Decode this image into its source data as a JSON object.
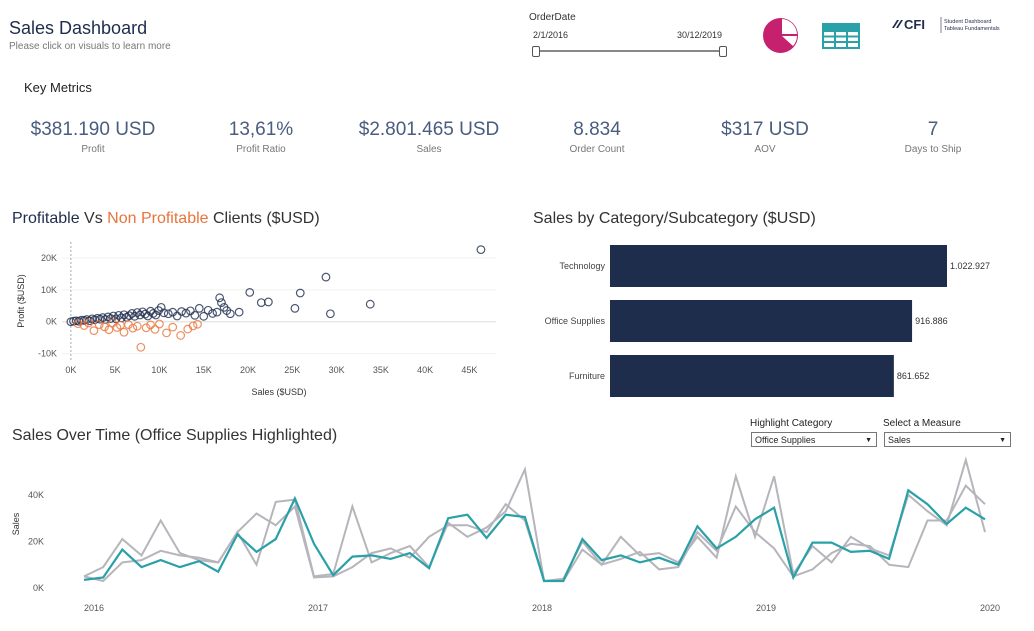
{
  "header": {
    "title": "Sales Dashboard",
    "subtitle": "Please click on visuals to learn more"
  },
  "filter": {
    "label": "OrderDate",
    "start": "2/1/2016",
    "end": "30/12/2019"
  },
  "icons": {
    "pie": "pie-chart-icon",
    "table": "table-icon",
    "logo_text": "CFI",
    "logo_sub1": "Student Dashboard",
    "logo_sub2": "Tableau Fundamentals"
  },
  "key_metrics": {
    "label": "Key Metrics",
    "items": [
      {
        "value": "$381.190 USD",
        "label": "Profit"
      },
      {
        "value": "13,61%",
        "label": "Profit Ratio"
      },
      {
        "value": "$2.801.465 USD",
        "label": "Sales"
      },
      {
        "value": "8.834",
        "label": "Order Count"
      },
      {
        "value": "$317 USD",
        "label": "AOV"
      },
      {
        "value": "7",
        "label": "Days to Ship"
      }
    ]
  },
  "scatter_title": {
    "part1": "Profitable",
    "part2": " Vs ",
    "part3": "Non Profitable",
    "part4": " Clients ($USD)"
  },
  "bar_title": "Sales by Category/Subcategory ($USD)",
  "line_title": "Sales Over Time (Office Supplies Highlighted)",
  "controls": {
    "highlight_label": "Highlight Category",
    "highlight_value": "Office Supplies",
    "measure_label": "Select a Measure",
    "measure_value": "Sales"
  },
  "colors": {
    "navy": "#1f2d4d",
    "orange": "#e8743b",
    "teal": "#2aa0a8",
    "gray": "#b5b5bb",
    "magenta": "#c5216e"
  },
  "chart_data": [
    {
      "type": "scatter",
      "xlabel": "Sales ($USD)",
      "ylabel": "Profit ($USD)",
      "xlim": [
        -1000,
        48000
      ],
      "ylim": [
        -12000,
        25000
      ],
      "x_ticks": [
        "0K",
        "5K",
        "10K",
        "15K",
        "20K",
        "25K",
        "30K",
        "35K",
        "40K",
        "45K"
      ],
      "y_ticks": [
        "20K",
        "10K",
        "0K",
        "-10K"
      ],
      "series": [
        {
          "name": "Profitable",
          "points": [
            [
              0,
              0
            ],
            [
              300,
              200
            ],
            [
              600,
              300
            ],
            [
              900,
              150
            ],
            [
              1200,
              500
            ],
            [
              1500,
              400
            ],
            [
              1800,
              700
            ],
            [
              2100,
              300
            ],
            [
              2400,
              900
            ],
            [
              2700,
              600
            ],
            [
              3000,
              1100
            ],
            [
              3300,
              800
            ],
            [
              3600,
              1300
            ],
            [
              3900,
              700
            ],
            [
              4200,
              1500
            ],
            [
              4500,
              1000
            ],
            [
              4800,
              1800
            ],
            [
              5100,
              900
            ],
            [
              5400,
              2000
            ],
            [
              5700,
              1200
            ],
            [
              6000,
              2200
            ],
            [
              6300,
              1400
            ],
            [
              6600,
              1900
            ],
            [
              6900,
              2600
            ],
            [
              7200,
              1700
            ],
            [
              7500,
              2900
            ],
            [
              7800,
              2100
            ],
            [
              8100,
              3100
            ],
            [
              8400,
              2400
            ],
            [
              8700,
              1800
            ],
            [
              9000,
              3300
            ],
            [
              9300,
              2600
            ],
            [
              9600,
              2100
            ],
            [
              9900,
              3500
            ],
            [
              10200,
              4500
            ],
            [
              10500,
              2800
            ],
            [
              11000,
              2500
            ],
            [
              11500,
              3000
            ],
            [
              12000,
              1800
            ],
            [
              12500,
              3200
            ],
            [
              13000,
              2700
            ],
            [
              13500,
              3400
            ],
            [
              14000,
              2000
            ],
            [
              14500,
              4200
            ],
            [
              15000,
              1700
            ],
            [
              15500,
              3600
            ],
            [
              16000,
              2600
            ],
            [
              16500,
              3000
            ],
            [
              16800,
              7500
            ],
            [
              17000,
              6000
            ],
            [
              17300,
              4500
            ],
            [
              17600,
              3500
            ],
            [
              18000,
              2500
            ],
            [
              19000,
              3000
            ],
            [
              20200,
              9200
            ],
            [
              21500,
              6000
            ],
            [
              22300,
              6200
            ],
            [
              25300,
              4200
            ],
            [
              25900,
              9000
            ],
            [
              28800,
              14000
            ],
            [
              29300,
              2500
            ],
            [
              33800,
              5500
            ],
            [
              46300,
              22600
            ]
          ]
        },
        {
          "name": "Non Profitable",
          "points": [
            [
              800,
              -600
            ],
            [
              1500,
              -1200
            ],
            [
              2000,
              -400
            ],
            [
              2600,
              -2800
            ],
            [
              3200,
              -900
            ],
            [
              3800,
              -1600
            ],
            [
              4300,
              -2500
            ],
            [
              4700,
              -400
            ],
            [
              5200,
              -1800
            ],
            [
              5600,
              -1100
            ],
            [
              6000,
              -3300
            ],
            [
              6500,
              -900
            ],
            [
              7000,
              -2000
            ],
            [
              7500,
              -1400
            ],
            [
              7900,
              -8000
            ],
            [
              8500,
              -1900
            ],
            [
              9000,
              -1000
            ],
            [
              9500,
              -2400
            ],
            [
              10000,
              -700
            ],
            [
              10800,
              -3500
            ],
            [
              11500,
              -1700
            ],
            [
              12400,
              -4300
            ],
            [
              13200,
              -2300
            ],
            [
              13800,
              -1300
            ],
            [
              14300,
              -800
            ]
          ]
        }
      ]
    },
    {
      "type": "bar",
      "categories": [
        "Technology",
        "Office Supplies",
        "Furniture"
      ],
      "values": [
        1022927,
        916886,
        861652
      ],
      "value_labels": [
        "1.022.927",
        "916.886",
        "861.652"
      ],
      "xlim": [
        0,
        1022927
      ]
    },
    {
      "type": "line",
      "ylabel": "Sales",
      "x_ticks": [
        "2016",
        "2017",
        "2018",
        "2019",
        "2020"
      ],
      "y_ticks": [
        "40K",
        "20K",
        "0K"
      ],
      "ylim": [
        0,
        55000
      ],
      "series": [
        {
          "name": "Office Supplies",
          "values": [
            3500,
            4500,
            16500,
            9000,
            12000,
            9000,
            11500,
            7000,
            23000,
            15500,
            21000,
            38500,
            19000,
            5500,
            13500,
            14000,
            12500,
            15000,
            8500,
            30000,
            31500,
            21500,
            31500,
            30500,
            3000,
            3000,
            21000,
            12000,
            14000,
            11000,
            13000,
            10000,
            26500,
            17000,
            22000,
            29500,
            34500,
            4500,
            19500,
            19500,
            15500,
            16000,
            12500,
            42000,
            36000,
            27500,
            34500,
            29500
          ],
          "highlight": true
        },
        {
          "name": "Technology",
          "values": [
            5000,
            9000,
            21000,
            14000,
            29000,
            15000,
            12000,
            11000,
            24000,
            10000,
            37000,
            38000,
            5000,
            6000,
            35000,
            11000,
            15000,
            18000,
            9000,
            28000,
            22000,
            26000,
            33000,
            51000,
            3000,
            4000,
            20000,
            10000,
            22000,
            14000,
            15000,
            11000,
            22000,
            13000,
            48000,
            22000,
            48000,
            6000,
            18000,
            11000,
            22000,
            17000,
            14000,
            40000,
            33000,
            27000,
            55000,
            24000
          ]
        },
        {
          "name": "Furniture",
          "values": [
            5000,
            3000,
            11000,
            12000,
            16000,
            14000,
            13000,
            11000,
            24000,
            32000,
            27000,
            35000,
            4500,
            5000,
            9000,
            15000,
            17000,
            13000,
            22000,
            27000,
            27000,
            24000,
            36000,
            29000,
            3000,
            3000,
            16500,
            10000,
            12500,
            15500,
            8000,
            9000,
            24000,
            16000,
            35000,
            24000,
            17000,
            5000,
            8000,
            15000,
            19000,
            18000,
            10000,
            9000,
            29000,
            29000,
            44000,
            36000
          ]
        }
      ]
    }
  ]
}
